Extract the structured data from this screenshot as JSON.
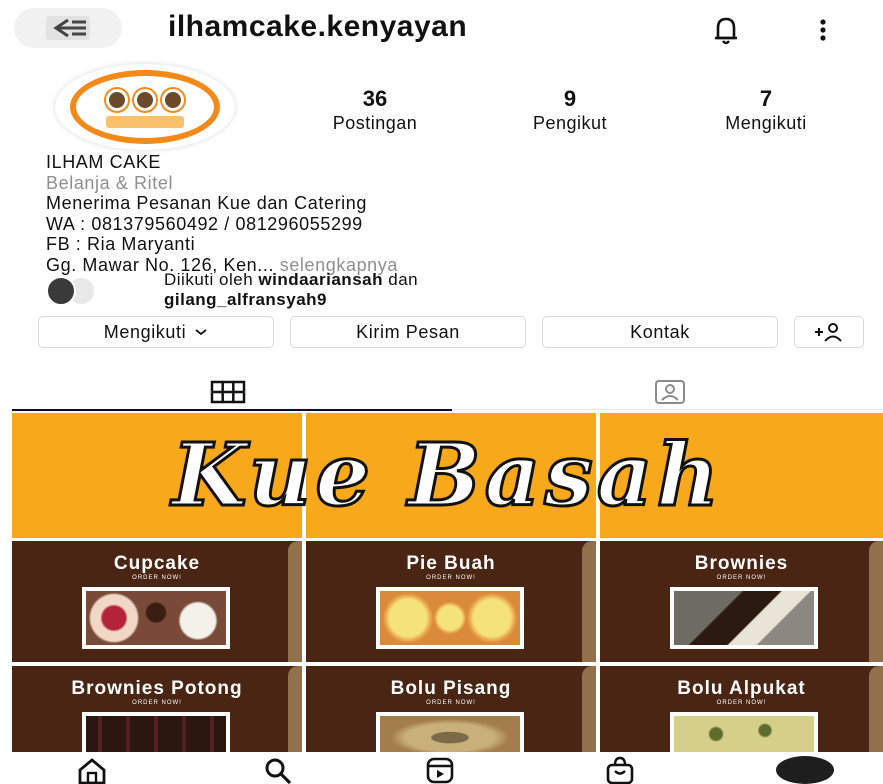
{
  "header": {
    "username": "ilhamcake.kenyayan"
  },
  "profile": {
    "stats": [
      {
        "value": "36",
        "label": "Postingan"
      },
      {
        "value": "9",
        "label": "Pengikut"
      },
      {
        "value": "7",
        "label": "Mengikuti"
      }
    ],
    "name": "ILHAM CAKE",
    "category": "Belanja & Ritel",
    "bio_lines": [
      "Menerima Pesanan Kue dan Catering",
      "WA : 081379560492 / 081296055299",
      "FB : Ria Maryanti",
      "Gg. Mawar No. 126, Ken..."
    ],
    "more_label": "selengkapnya",
    "followed_by": {
      "prefix": "Diikuti oleh",
      "user1": "windaariansah",
      "joiner": "dan",
      "user2": "gilang_alfransyah9"
    }
  },
  "actions": {
    "following": "Mengikuti",
    "message": "Kirim Pesan",
    "contact": "Kontak"
  },
  "tabs": {
    "grid_icon": "grid-icon",
    "tagged_icon": "tagged-icon"
  },
  "posts": {
    "banner": "Kue Basah",
    "order_label": "ORDER NOW!",
    "items": [
      {
        "name": "Cupcake"
      },
      {
        "name": "Pie Buah"
      },
      {
        "name": "Brownies"
      },
      {
        "name": "Brownies Potong"
      },
      {
        "name": "Bolu Pisang"
      },
      {
        "name": "Bolu Alpukat"
      }
    ]
  },
  "bottom_nav": [
    "home-icon",
    "search-icon",
    "reels-icon",
    "shop-icon",
    "profile-avatar"
  ],
  "colors": {
    "banner_bg": "#f7a81b",
    "tile_bg": "#4a2513",
    "avatar_ring": "#f28a1a",
    "muted_text": "#8e8e8e"
  }
}
